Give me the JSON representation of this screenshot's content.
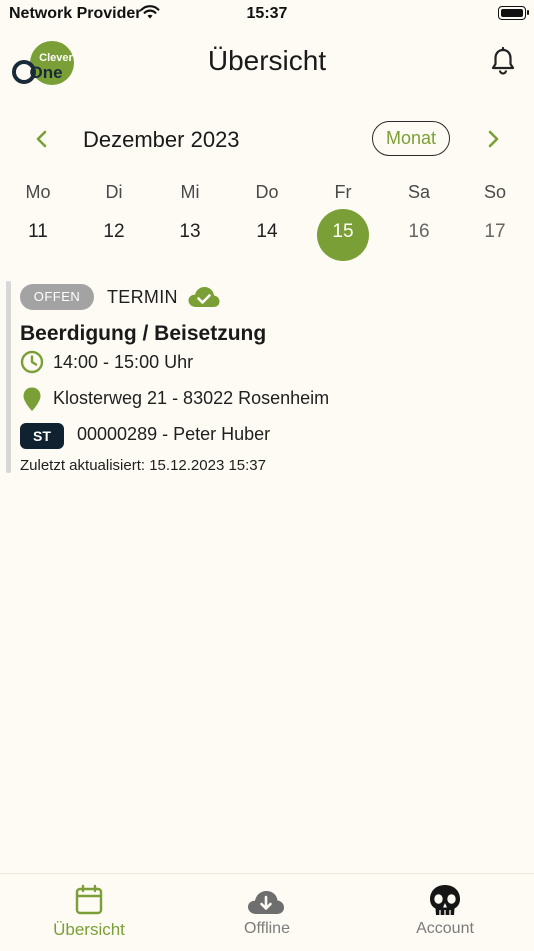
{
  "status_bar": {
    "carrier": "Network Provider",
    "time": "15:37"
  },
  "header": {
    "logo_text_top": "Clever",
    "logo_text_main": "One",
    "title": "Übersicht"
  },
  "calendar": {
    "month_label": "Dezember 2023",
    "view_button": "Monat",
    "days": [
      {
        "weekday": "Mo",
        "date": "11"
      },
      {
        "weekday": "Di",
        "date": "12"
      },
      {
        "weekday": "Mi",
        "date": "13"
      },
      {
        "weekday": "Do",
        "date": "14"
      },
      {
        "weekday": "Fr",
        "date": "15"
      },
      {
        "weekday": "Sa",
        "date": "16"
      },
      {
        "weekday": "So",
        "date": "17"
      }
    ],
    "selected_date": "15"
  },
  "event": {
    "status": "OFFEN",
    "type": "TERMIN",
    "title": "Beerdigung / Beisetzung",
    "time": "14:00 - 15:00 Uhr",
    "address": "Klosterweg 21 - 83022 Rosenheim",
    "tag": "ST",
    "reference": "00000289 - Peter Huber",
    "updated": "Zuletzt aktualisiert: 15.12.2023 15:37"
  },
  "tabs": [
    {
      "label": "Übersicht",
      "icon": "calendar-icon",
      "active": true
    },
    {
      "label": "Offline",
      "icon": "cloud-download-icon",
      "active": false
    },
    {
      "label": "Account",
      "icon": "skull-icon",
      "active": false
    }
  ],
  "colors": {
    "accent": "#7a9f36",
    "background": "#fdfbf3",
    "status_badge": "#a3a3a3",
    "tag_badge": "#10212f"
  }
}
